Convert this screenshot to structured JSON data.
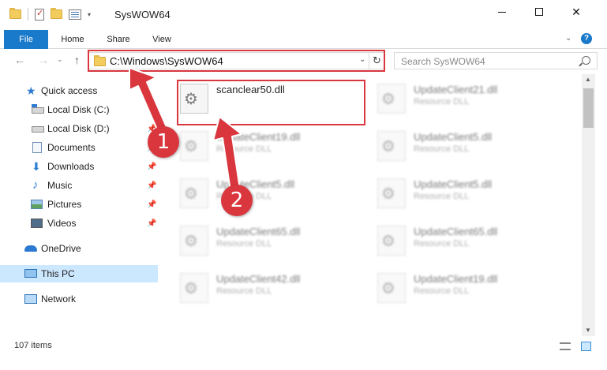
{
  "window": {
    "title": "SysWOW64",
    "caret": "▾",
    "min_symbol": "—",
    "max_symbol": "☐",
    "close_symbol": "✕"
  },
  "ribbon": {
    "tabs": [
      "File",
      "Home",
      "Share",
      "View"
    ],
    "collapse_symbol": "⌄",
    "help_symbol": "?"
  },
  "nav": {
    "back_symbol": "←",
    "forward_symbol": "→",
    "recent_symbol": "⌄",
    "up_symbol": "↑"
  },
  "address": {
    "path": "C:\\Windows\\SysWOW64",
    "dropdown_symbol": "⌄",
    "refresh_symbol": "↻"
  },
  "search": {
    "placeholder": "Search SysWOW64"
  },
  "sidebar": {
    "items": [
      {
        "label": "Quick access",
        "icon": "star-icon",
        "pinned": false
      },
      {
        "label": "Local Disk (C:)",
        "icon": "drive-icon",
        "pinned": false
      },
      {
        "label": "Local Disk (D:)",
        "icon": "drive-icon",
        "pinned": true
      },
      {
        "label": "Documents",
        "icon": "documents-icon",
        "pinned": true
      },
      {
        "label": "Downloads",
        "icon": "downloads-icon",
        "pinned": true
      },
      {
        "label": "Music",
        "icon": "music-icon",
        "pinned": true
      },
      {
        "label": "Pictures",
        "icon": "pictures-icon",
        "pinned": true
      },
      {
        "label": "Videos",
        "icon": "videos-icon",
        "pinned": true
      },
      {
        "label": "OneDrive",
        "icon": "onedrive-icon",
        "pinned": false
      },
      {
        "label": "This PC",
        "icon": "pc-icon",
        "pinned": false,
        "selected": true
      },
      {
        "label": "Network",
        "icon": "network-icon",
        "pinned": false
      }
    ],
    "pin_symbol": "📌"
  },
  "files": [
    {
      "name": "scanclear50.dll",
      "type": "",
      "blurred": false
    },
    {
      "name": "UpdateClient21.dll",
      "type": "Resource DLL",
      "blurred": true
    },
    {
      "name": "UpdateClient19.dll",
      "type": "Resource DLL",
      "blurred": true
    },
    {
      "name": "UpdateClient5.dll",
      "type": "Resource DLL",
      "blurred": true
    },
    {
      "name": "UpdateClient5.dll",
      "type": "Resource DLL",
      "blurred": true
    },
    {
      "name": "UpdateClient5.dll",
      "type": "Resource DLL",
      "blurred": true
    },
    {
      "name": "UpdateClient65.dll",
      "type": "Resource DLL",
      "blurred": true
    },
    {
      "name": "UpdateClient65.dll",
      "type": "Resource DLL",
      "blurred": true
    },
    {
      "name": "UpdateClient42.dll",
      "type": "Resource DLL",
      "blurred": true
    },
    {
      "name": "UpdateClient19.dll",
      "type": "Resource DLL",
      "blurred": true
    }
  ],
  "status": {
    "item_count": "107 items"
  },
  "annotations": {
    "step1": "1",
    "step2": "2",
    "highlight_color": "#d9363e"
  },
  "colors": {
    "accent": "#1979ca",
    "selection": "#cce8ff",
    "annotation_red": "#d9363e"
  }
}
